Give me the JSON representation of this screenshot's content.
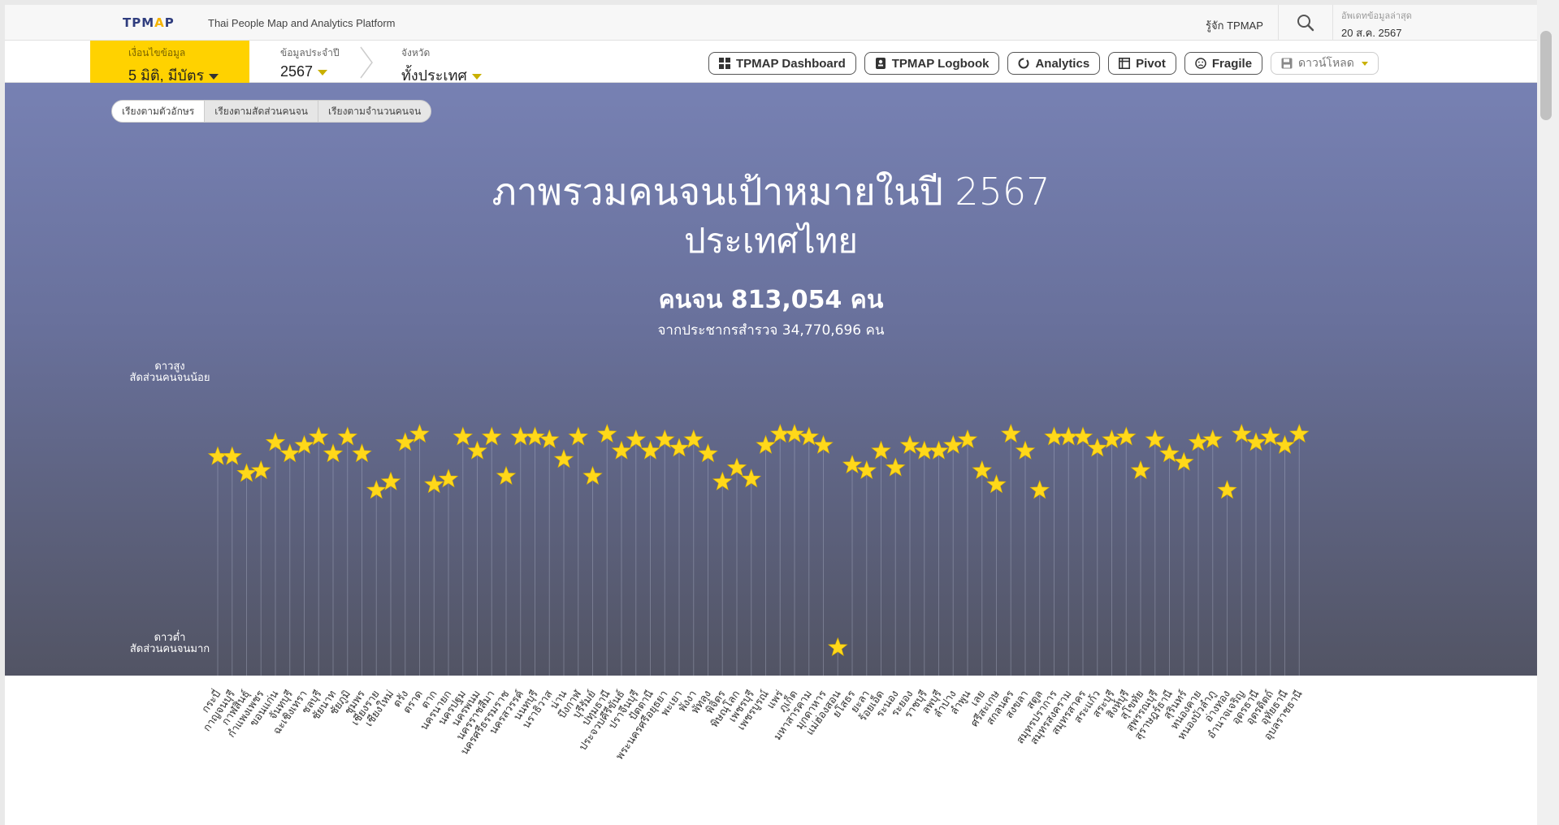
{
  "header": {
    "logo_prefix": "TPM",
    "logo_star": "A",
    "logo_suffix": "P",
    "tagline": "Thai People Map and Analytics Platform",
    "about": "รู้จัก TPMAP",
    "search_icon": "search-icon",
    "updated_label": "อัพเดทข้อมูลล่าสุด",
    "updated_value": "20 ส.ค. 2567"
  },
  "filters": {
    "condition_label": "เงื่อนไขข้อมูล",
    "condition_value": "5 มิติ, มีบัตร",
    "year_label": "ข้อมูลประจำปี",
    "year_value": "2567",
    "province_label": "จังหวัด",
    "province_value": "ทั้งประเทศ"
  },
  "nav": {
    "dashboard": "TPMAP Dashboard",
    "logbook": "TPMAP Logbook",
    "analytics": "Analytics",
    "pivot": "Pivot",
    "fragile": "Fragile",
    "download": "ดาวน์โหลด"
  },
  "sort_tabs": [
    "เรียงตามตัวอักษร",
    "เรียงตามสัดส่วนคนจน",
    "เรียงตามจำนวนคนจน"
  ],
  "main": {
    "title_line1": "ภาพรวมคนจนเป้าหมายในปี 2567",
    "title_line2": "ประเทศไทย",
    "poor_count": "คนจน 813,054 คน",
    "population": "จากประชากรสำรวจ 34,770,696 คน",
    "axis_high_1": "ดาวสูง",
    "axis_high_2": "สัดส่วนคนจนน้อย",
    "axis_low_1": "ดาวต่ำ",
    "axis_low_2": "สัดส่วนคนจนมาก"
  },
  "colors": {
    "accent_yellow": "#ffd200",
    "star": "#ffd81a",
    "brand_blue": "#2f3d7e"
  },
  "chart_data": {
    "type": "scatter",
    "ylim": [
      0,
      1
    ],
    "series": [
      {
        "categories": [
          "กระบี่",
          "กาญจนบุรี",
          "กาฬสินธุ์",
          "กำแพงเพชร",
          "ขอนแก่น",
          "จันทบุรี",
          "ฉะเชิงเทรา",
          "ชลบุรี",
          "ชัยนาท",
          "ชัยภูมิ",
          "ชุมพร",
          "เชียงราย",
          "เชียงใหม่",
          "ตรัง",
          "ตราด",
          "ตาก",
          "นครนายก",
          "นครปฐม",
          "นครพนม",
          "นครราชสีมา",
          "นครศรีธรรมราช",
          "นครสวรรค์",
          "นนทบุรี",
          "นราธิวาส",
          "น่าน",
          "บึงกาฬ",
          "บุรีรัมย์",
          "ปทุมธานี",
          "ประจวบคีรีขันธ์",
          "ปราจีนบุรี",
          "ปัตตานี",
          "พระนครศรีอยุธยา",
          "พะเยา",
          "พังงา",
          "พัทลุง",
          "พิจิตร",
          "พิษณุโลก",
          "เพชรบุรี",
          "เพชรบูรณ์",
          "แพร่",
          "ภูเก็ต",
          "มหาสารคาม",
          "มุกดาหาร",
          "แม่ฮ่องสอน",
          "ยโสธร",
          "ยะลา",
          "ร้อยเอ็ด",
          "ระนอง",
          "ระยอง",
          "ราชบุรี",
          "ลพบุรี",
          "ลำปาง",
          "ลำพูน",
          "เลย",
          "ศรีสะเกษ",
          "สกลนคร",
          "สงขลา",
          "สตูล",
          "สมุทรปราการ",
          "สมุทรสงคราม",
          "สมุทรสาคร",
          "สระแก้ว",
          "สระบุรี",
          "สิงห์บุรี",
          "สุโขทัย",
          "สุพรรณบุรี",
          "สุราษฎร์ธานี",
          "สุรินทร์",
          "หนองคาย",
          "หนองบัวลำภู",
          "อ่างทอง",
          "อำนาจเจริญ",
          "อุดรธานี",
          "อุตรดิตถ์",
          "อุทัยธานี",
          "อุบลราชธานี"
        ],
        "values": [
          0.71,
          0.71,
          0.65,
          0.66,
          0.76,
          0.72,
          0.75,
          0.78,
          0.72,
          0.78,
          0.72,
          0.59,
          0.62,
          0.76,
          0.79,
          0.61,
          0.63,
          0.78,
          0.73,
          0.78,
          0.64,
          0.78,
          0.78,
          0.77,
          0.7,
          0.78,
          0.64,
          0.79,
          0.73,
          0.77,
          0.73,
          0.77,
          0.74,
          0.77,
          0.72,
          0.62,
          0.67,
          0.63,
          0.75,
          0.79,
          0.79,
          0.78,
          0.75,
          0.03,
          0.68,
          0.66,
          0.73,
          0.67,
          0.75,
          0.73,
          0.73,
          0.75,
          0.77,
          0.66,
          0.61,
          0.79,
          0.73,
          0.59,
          0.78,
          0.78,
          0.78,
          0.74,
          0.77,
          0.78,
          0.66,
          0.77,
          0.72,
          0.69,
          0.76,
          0.77,
          0.59,
          0.79,
          0.76,
          0.78,
          0.75,
          0.79
        ]
      }
    ]
  }
}
